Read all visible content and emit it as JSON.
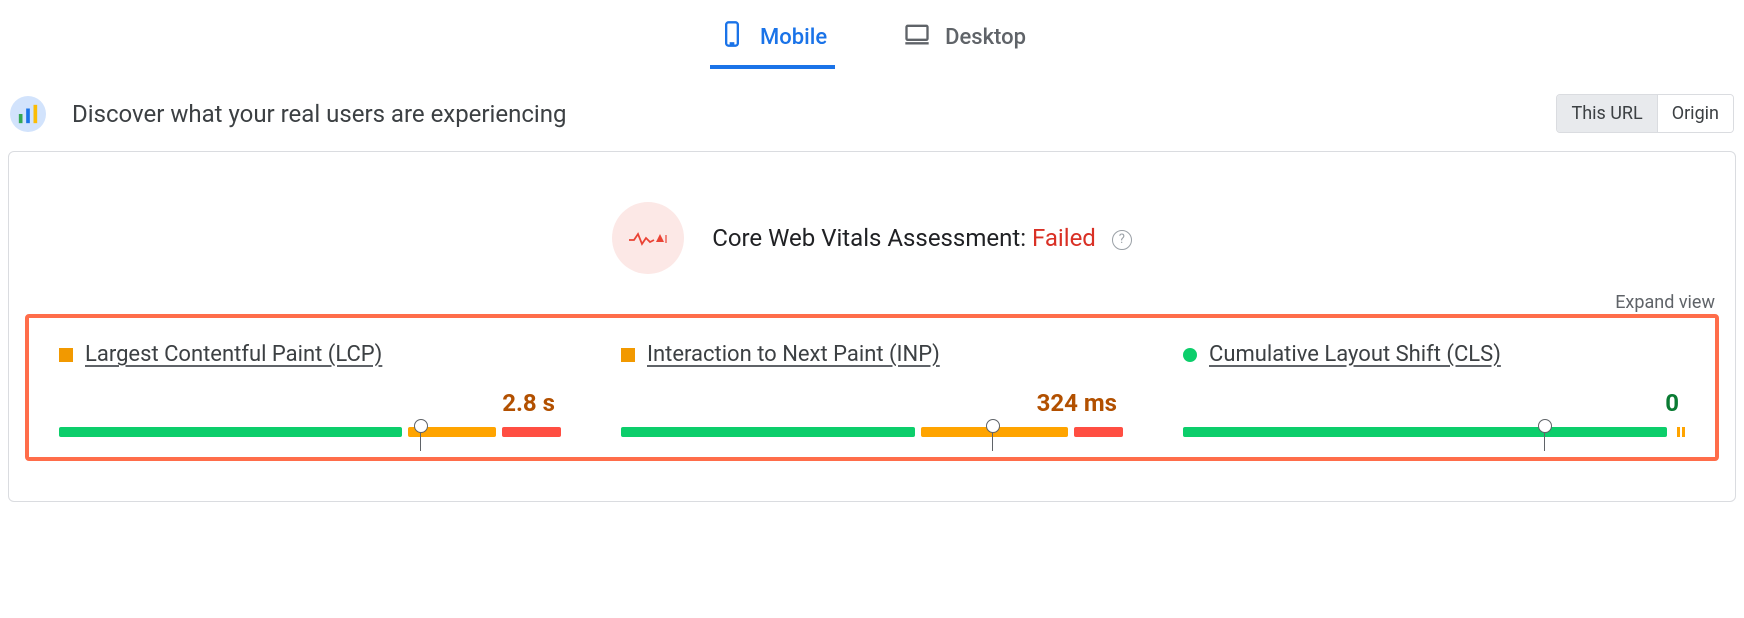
{
  "tabs": {
    "mobile": "Mobile",
    "desktop": "Desktop",
    "active": "mobile"
  },
  "header": {
    "title": "Discover what your real users are experiencing",
    "scope_toggle": {
      "this_url": "This URL",
      "origin": "Origin",
      "selected": "this_url"
    }
  },
  "assessment": {
    "prefix": "Core Web Vitals Assessment: ",
    "status": "Failed"
  },
  "controls": {
    "expand": "Expand view"
  },
  "metrics": {
    "lcp": {
      "label": "Largest Contentful Paint (LCP)",
      "value": "2.8 s",
      "status": "warn",
      "bar": {
        "green": 70,
        "yellow": 18,
        "red": 12,
        "marker_pct": 72
      }
    },
    "inp": {
      "label": "Interaction to Next Paint (INP)",
      "value": "324 ms",
      "status": "warn",
      "bar": {
        "green": 60,
        "yellow": 30,
        "red": 10,
        "marker_pct": 74
      }
    },
    "cls": {
      "label": "Cumulative Layout Shift (CLS)",
      "value": "0",
      "status": "good",
      "bar": {
        "green": 96,
        "yellow_dashes": true,
        "marker_pct": 72
      }
    }
  }
}
